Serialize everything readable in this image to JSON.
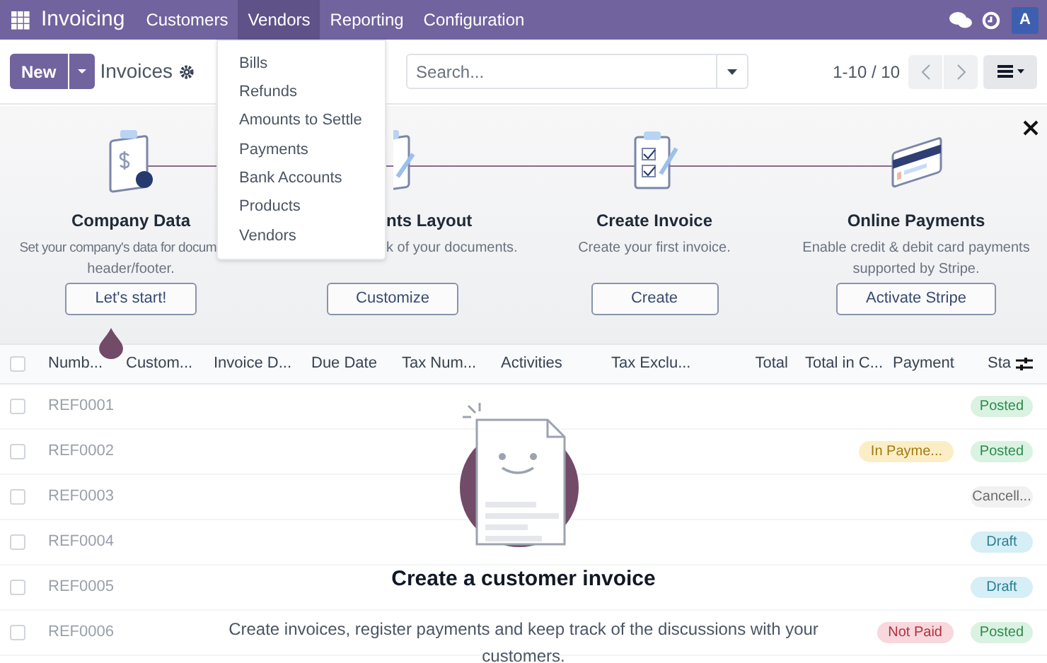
{
  "navbar": {
    "app": "Invoicing",
    "menus": [
      {
        "label": "Customers",
        "selected": false
      },
      {
        "label": "Vendors",
        "selected": true
      },
      {
        "label": "Reporting",
        "selected": false
      },
      {
        "label": "Configuration",
        "selected": false
      }
    ],
    "avatar": "A"
  },
  "vendors_menu": [
    "Bills",
    "Refunds",
    "Amounts to Settle",
    "Payments",
    "Bank Accounts",
    "Products",
    "Vendors"
  ],
  "control_panel": {
    "new_button": "New",
    "title": "Invoices",
    "search": {
      "placeholder": "Search..."
    },
    "pager": "1-10 / 10"
  },
  "onboarding": [
    {
      "title": "Company Data",
      "description": [
        "Set your company's data for docum",
        "header/footer."
      ],
      "button": "Let's start!"
    },
    {
      "title": "nts Layout",
      "description": [
        "k of your documents."
      ],
      "button": "Customize"
    },
    {
      "title": "Create Invoice",
      "description": [
        "Create your first invoice."
      ],
      "button": "Create"
    },
    {
      "title": "Online Payments",
      "description": [
        "Enable credit & debit card payments",
        "supported by Stripe."
      ],
      "button": "Activate Stripe"
    }
  ],
  "table": {
    "select_all_checked": false,
    "columns": [
      "Numb...",
      "Custom...",
      "Invoice D...",
      "Due Date",
      "Tax Num...",
      "Activities",
      "Tax Exclu...",
      "Total",
      "Total in C...",
      "Payment",
      "Sta"
    ],
    "rows": [
      {
        "checked": false,
        "number": "REF0001",
        "status": {
          "text": "Posted",
          "kind": "posted"
        }
      },
      {
        "checked": false,
        "number": "REF0002",
        "payment": {
          "text": "In Payme...",
          "kind": "partial"
        },
        "status": {
          "text": "Posted",
          "kind": "posted"
        }
      },
      {
        "checked": false,
        "number": "REF0003",
        "status": {
          "text": "Cancell...",
          "kind": "cancelled"
        }
      },
      {
        "checked": false,
        "number": "REF0004",
        "status": {
          "text": "Draft",
          "kind": "draft"
        }
      },
      {
        "checked": false,
        "number": "REF0005",
        "status": {
          "text": "Draft",
          "kind": "draft"
        }
      },
      {
        "checked": false,
        "number": "REF0006",
        "payment": {
          "text": "Not Paid",
          "kind": "unpaid"
        },
        "status": {
          "text": "Posted",
          "kind": "posted"
        }
      }
    ]
  },
  "empty_state": {
    "title": "Create a customer invoice",
    "text": "Create invoices, register payments and keep track of the discussions with your customers."
  }
}
